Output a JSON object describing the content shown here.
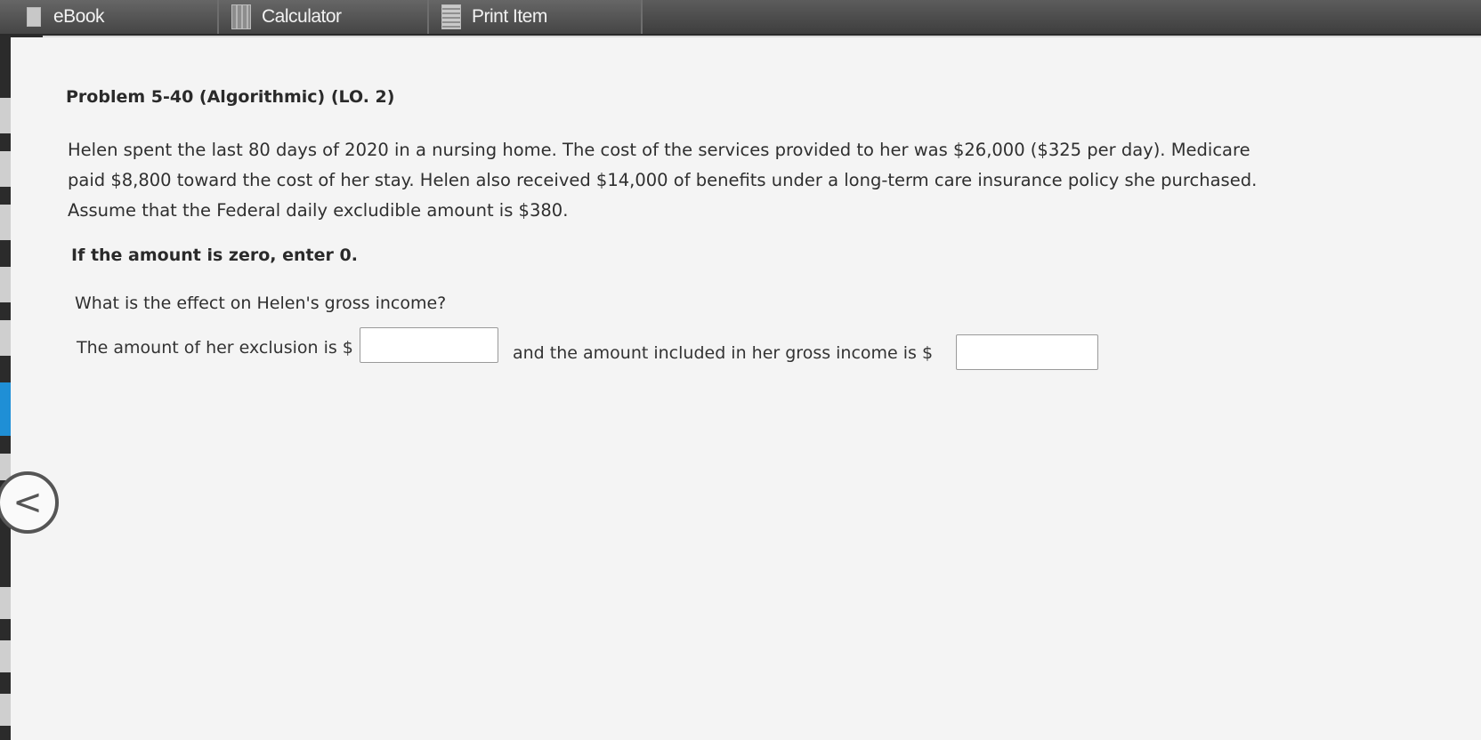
{
  "toolbar": {
    "tabs": [
      {
        "label": "eBook",
        "icon": "book-icon"
      },
      {
        "label": "Calculator",
        "icon": "calculator-icon"
      },
      {
        "label": "Print Item",
        "icon": "print-icon"
      }
    ]
  },
  "problem": {
    "title": "Problem 5-40 (Algorithmic) (LO. 2)",
    "body": "Helen spent the last 80 days of 2020 in a nursing home. The cost of the services provided to her was $26,000 ($325 per day). Medicare paid $8,800 toward the cost of her stay. Helen also received $14,000 of benefits under a long-term care insurance policy she purchased. Assume that the Federal daily excludible amount is $380.",
    "instruction": "If the amount is zero, enter 0.",
    "question": "What is the effect on Helen's gross income?",
    "answer": {
      "exclusion_label": "The amount of her exclusion is $",
      "exclusion_value": "",
      "included_label": "and the amount included in her gross income is $",
      "included_value": ""
    }
  },
  "nav": {
    "back_glyph": "<"
  }
}
